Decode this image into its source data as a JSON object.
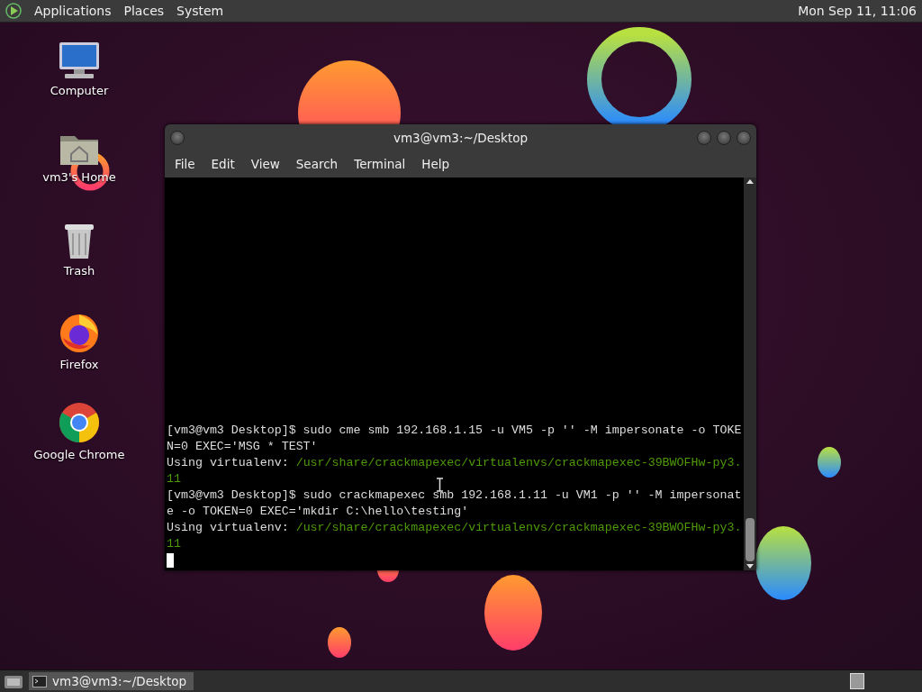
{
  "top_panel": {
    "menus": [
      "Applications",
      "Places",
      "System"
    ],
    "clock": "Mon Sep 11, 11:06"
  },
  "desktop_icons": [
    {
      "label": "Computer",
      "kind": "computer"
    },
    {
      "label": "vm3's Home",
      "kind": "home"
    },
    {
      "label": "Trash",
      "kind": "trash"
    },
    {
      "label": "Firefox",
      "kind": "firefox"
    },
    {
      "label": "Google Chrome",
      "kind": "chrome"
    }
  ],
  "window": {
    "title": "vm3@vm3:~/Desktop",
    "menu": [
      "File",
      "Edit",
      "View",
      "Search",
      "Terminal",
      "Help"
    ],
    "terminal_lines": [
      {
        "segments": [
          {
            "text": "[vm3@vm3 Desktop]$ sudo cme smb 192.168.1.15 -u VM5 -p '' -M impersonate -o TOKE",
            "kind": "plain"
          }
        ]
      },
      {
        "segments": [
          {
            "text": "N=0 EXEC='MSG * TEST'",
            "kind": "plain"
          }
        ]
      },
      {
        "segments": [
          {
            "text": "Using virtualenv:",
            "kind": "plain"
          },
          {
            "text": "/usr/share/crackmapexec/virtualenvs/crackmapexec-39BWOFHw-py3.",
            "kind": "path"
          }
        ]
      },
      {
        "segments": [
          {
            "text": "11",
            "kind": "path"
          }
        ]
      },
      {
        "segments": [
          {
            "text": "[vm3@vm3 Desktop]$ sudo crackmapexec smb 192.168.1.11 -u VM1 -p '' -M impersonat",
            "kind": "plain"
          }
        ]
      },
      {
        "segments": [
          {
            "text": "e -o TOKEN=0 EXEC='mkdir C:\\hello\\testing'",
            "kind": "plain"
          }
        ]
      },
      {
        "segments": [
          {
            "text": "Using virtualenv:",
            "kind": "plain"
          },
          {
            "text": "/usr/share/crackmapexec/virtualenvs/crackmapexec-39BWOFHw-py3.",
            "kind": "path"
          }
        ]
      },
      {
        "segments": [
          {
            "text": "11",
            "kind": "path"
          }
        ]
      }
    ]
  },
  "taskbar": {
    "tasks": [
      {
        "label": "vm3@vm3:~/Desktop",
        "selected": true
      }
    ]
  }
}
